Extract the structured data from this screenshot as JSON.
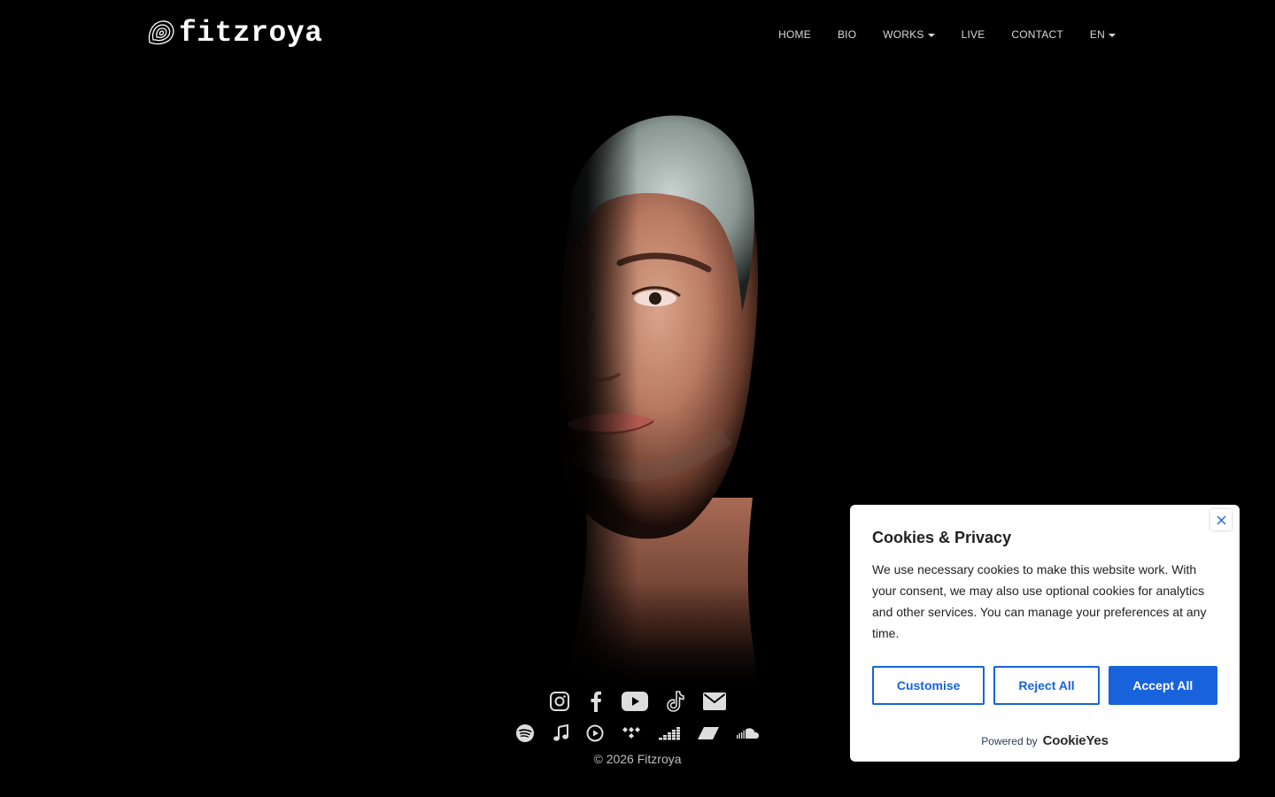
{
  "brand": {
    "name": "fitzroya"
  },
  "nav": {
    "items": [
      {
        "label": "HOME",
        "dropdown": false
      },
      {
        "label": "BIO",
        "dropdown": false
      },
      {
        "label": "WORKS",
        "dropdown": true
      },
      {
        "label": "LIVE",
        "dropdown": false
      },
      {
        "label": "CONTACT",
        "dropdown": false
      },
      {
        "label": "EN",
        "dropdown": true
      }
    ]
  },
  "social": {
    "primary": [
      "instagram-icon",
      "facebook-icon",
      "youtube-icon",
      "tiktok-icon",
      "mail-icon"
    ],
    "streaming": [
      "spotify-icon",
      "apple-music-icon",
      "youtube-music-icon",
      "tidal-icon",
      "deezer-icon",
      "bandcamp-icon",
      "soundcloud-icon"
    ]
  },
  "footer": {
    "copyright": "© 2026 Fitzroya"
  },
  "cookie": {
    "title": "Cookies & Privacy",
    "text": "We use necessary cookies to make this website work. With your consent, we may also use optional cookies for analytics and other services. You can manage your preferences at any time.",
    "customise_label": "Customise",
    "reject_label": "Reject All",
    "accept_label": "Accept All",
    "powered_by": "Powered by",
    "powered_brand": "CookieYes",
    "accent": "#1863dc"
  },
  "colors": {
    "background": "#000000",
    "nav_text": "#d8d8d8"
  }
}
